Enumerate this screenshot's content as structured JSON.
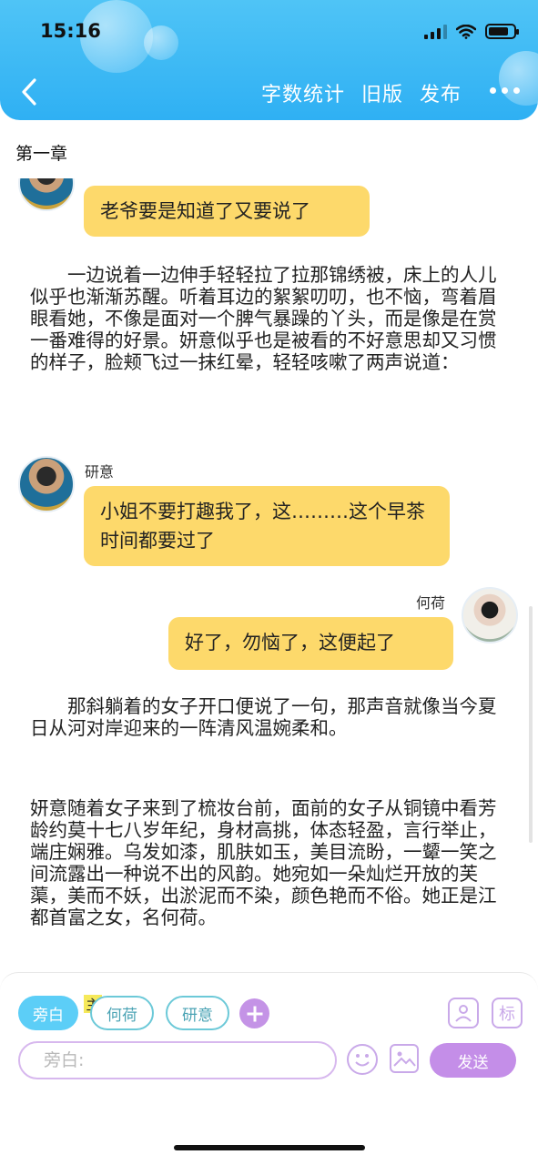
{
  "status_bar": {
    "time": "15:16",
    "battery_level": 0.75
  },
  "header": {
    "actions": [
      "字数统计",
      "旧版",
      "发布"
    ],
    "colors": {
      "accent": "#2fb0f3",
      "bubble": "#fdd96b",
      "purple": "#c48ee8"
    }
  },
  "chapter": {
    "title": "第一章"
  },
  "messages": {
    "m1": {
      "text": "老爷要是知道了又要说了"
    },
    "n1": {
      "text": "　　一边说着一边伸手轻轻拉了拉那锦绣被，床上的人儿似乎也渐渐苏醒。听着耳边的絮絮叨叨，也不恼，弯着眉眼看她，不像是面对一个脾气暴躁的丫头，而是像是在赏一番难得的好景。妍意似乎也是被看的不好意思却又习惯的样子，脸颊飞过一抹红晕，轻轻咳嗽了两声说道："
    },
    "m2": {
      "speaker": "研意",
      "text": "小姐不要打趣我了，这………这个早茶时间都要过了"
    },
    "m3": {
      "speaker": "何荷",
      "text": "好了，勿恼了，这便起了"
    },
    "n2": {
      "text": "　　那斜躺着的女子开口便说了一句，那声音就像当今夏日从河对岸迎来的一阵清风温婉柔和。"
    },
    "n3": {
      "text": "妍意随着女子来到了梳妆台前，面前的女子从铜镜中看芳龄约莫十七八岁年纪，身材高挑，体态轻盈，言行举止，端庄娴雅。乌发如漆，肌肤如玉，美目流盼，一颦一笑之间流露出一种说不出的风韵。她宛如一朵灿烂开放的芙蕖，美而不妖，出淤泥而不染，颜色艳而不俗。她正是江都首富之女，名何荷。"
    }
  },
  "composer": {
    "roles": [
      "旁白",
      "何荷",
      "研意"
    ],
    "main_tag": "主",
    "tag_icon_label": "标",
    "input_placeholder": "旁白:",
    "send_label": "发送"
  }
}
